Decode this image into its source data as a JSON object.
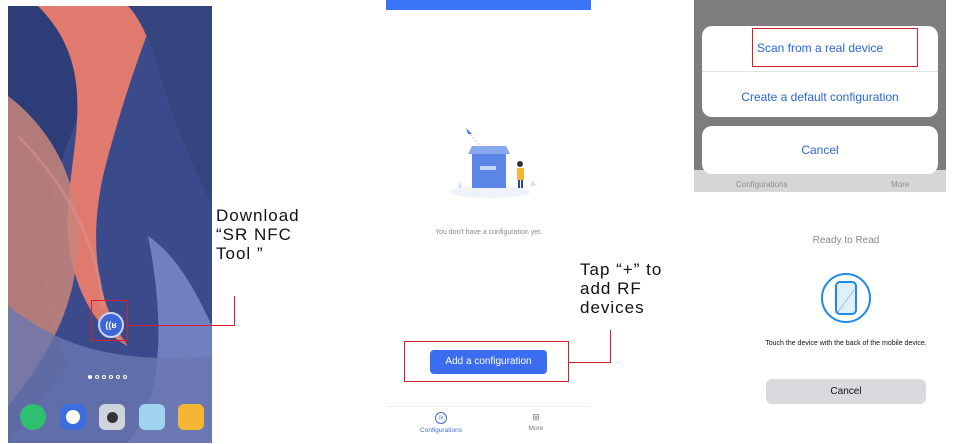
{
  "annotations": {
    "download": "Download\n“SR NFC\nTool ”",
    "tap": "Tap “+” to\nadd RF\ndevices"
  },
  "app_screen": {
    "empty_message": "You don't have a configuration yet.",
    "add_button_label": "Add a configuration",
    "tabs": [
      {
        "label": "Configurations",
        "icon": "nfc-icon"
      },
      {
        "label": "More",
        "icon": "grid-icon"
      }
    ]
  },
  "action_sheet": {
    "scan_label": "Scan from a real device",
    "create_label": "Create a default configuration",
    "cancel_label": "Cancel",
    "behind_tabs": [
      "Configurations",
      "More"
    ]
  },
  "nfc_dialog": {
    "title": "Ready to Read",
    "message": "Touch the device with the back of the mobile device.",
    "cancel_label": "Cancel"
  },
  "colors": {
    "accent_blue": "#3c6df0",
    "highlight_red": "#d4202a"
  }
}
